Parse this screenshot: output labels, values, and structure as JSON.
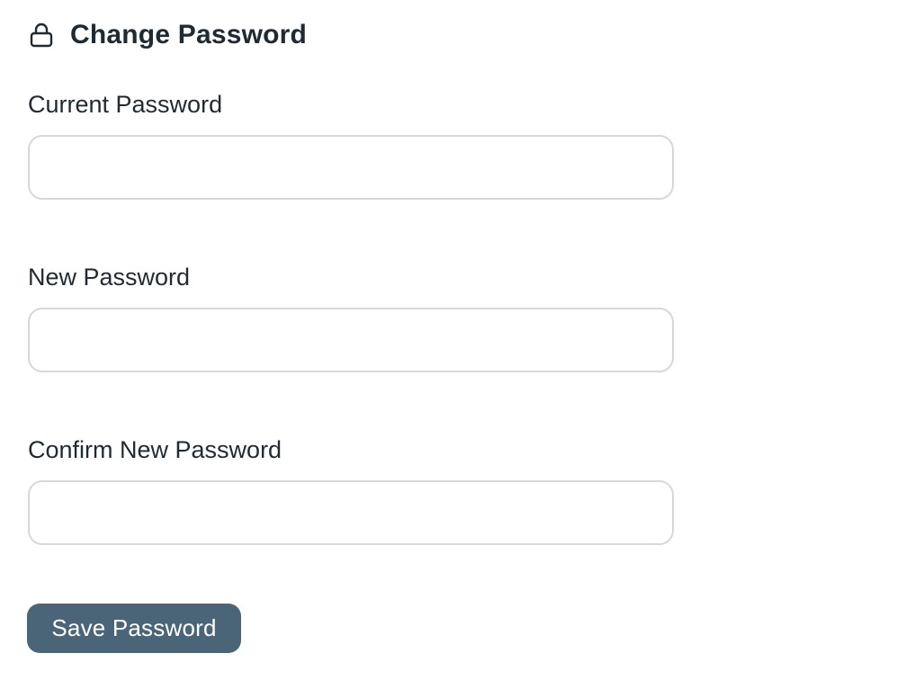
{
  "header": {
    "icon": "lock-icon",
    "title": "Change Password"
  },
  "form": {
    "current_password": {
      "label": "Current Password",
      "value": "",
      "placeholder": ""
    },
    "new_password": {
      "label": "New Password",
      "value": "",
      "placeholder": ""
    },
    "confirm_password": {
      "label": "Confirm New Password",
      "value": "",
      "placeholder": ""
    },
    "save_label": "Save Password"
  },
  "colors": {
    "primary_button": "#4a6577",
    "text": "#1f2a33",
    "input_border": "#d3d9de"
  }
}
